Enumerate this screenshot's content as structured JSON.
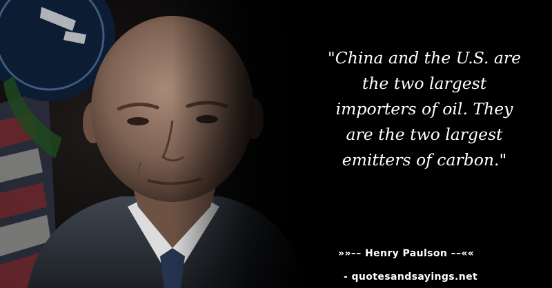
{
  "quote": {
    "lines": [
      "\"China and the U.S. are",
      "the two largest",
      "importers of oil. They",
      "are the two largest",
      "emitters of carbon.\""
    ]
  },
  "attribution": {
    "prefix": "»»–– ",
    "author": "Henry Paulson",
    "suffix": " ––««"
  },
  "source": "- quotesandsayings.net",
  "photo": {
    "subject": "man-portrait",
    "background_elements": [
      "us-flag",
      "department-seal"
    ]
  },
  "colors": {
    "background": "#000000",
    "text": "#ffffff"
  }
}
